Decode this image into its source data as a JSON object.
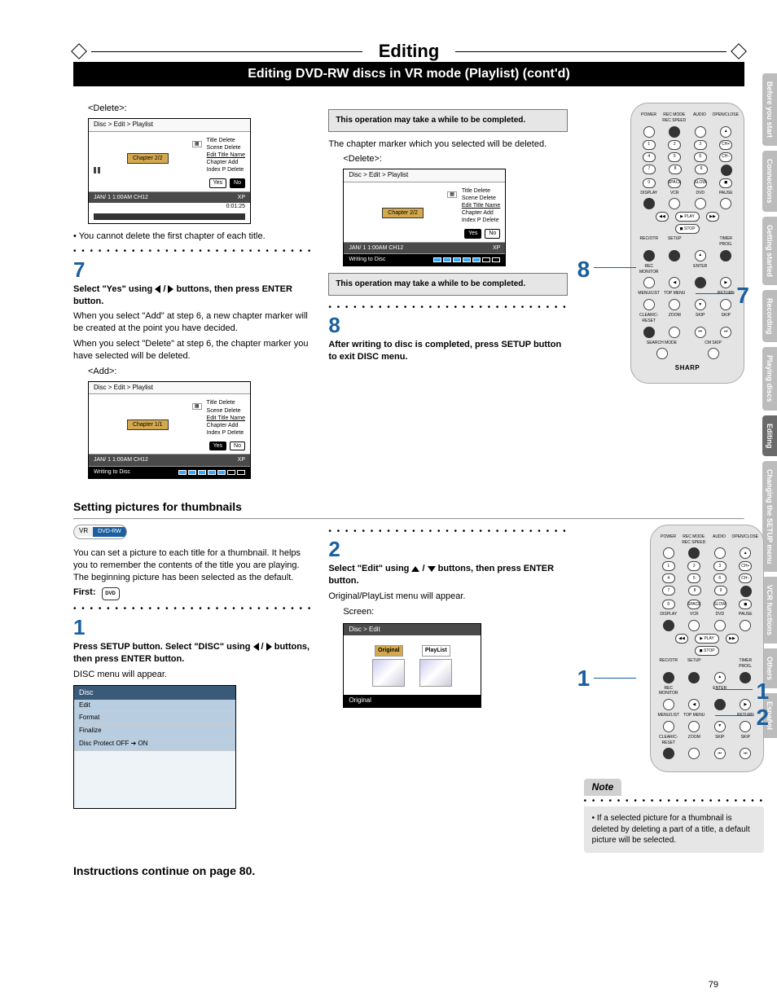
{
  "page_title": "Editing",
  "subtitle": "Editing DVD-RW discs in VR mode (Playlist) (cont'd)",
  "page_number": "79",
  "side_tabs": [
    "Before you start",
    "Connections",
    "Getting started",
    "Recording",
    "Playing discs",
    "Editing",
    "Changing the SETUP menu",
    "VCR functions",
    "Others",
    "Español"
  ],
  "side_tab_active": "Editing",
  "col1": {
    "delete_label": "<Delete>:",
    "screen1": {
      "breadcrumb": "Disc > Edit > Playlist",
      "chapter": "Chapter 2/2",
      "menu": [
        "Title Delete",
        "Scene Delete",
        "Edit Title Name",
        "Chapter Add",
        "Index P Delete"
      ],
      "menu_sel": "Edit Title Name",
      "yes": "Yes",
      "no": "No",
      "footer_left": "JAN/ 1   1:00AM  CH12",
      "footer_mid": "XP",
      "footer_time": "0:01:25"
    },
    "bullet1": "• You cannot delete the first chapter of each title.",
    "step7_num": "7",
    "step7_body": "Select \"Yes\" using ◀ / ▶ buttons, then press ENTER button.",
    "step7_text1": "When you select \"Add\" at step 6, a new chapter marker will be created at the point you have decided.",
    "step7_text2": "When you select \"Delete\" at step 6, the chapter marker you have selected will be deleted.",
    "add_label": "<Add>:",
    "screen2": {
      "breadcrumb": "Disc > Edit > Playlist",
      "chapter": "Chapter 1/1",
      "yes": "Yes",
      "no": "No",
      "footer_left": "JAN/ 1   1:00AM  CH12",
      "footer_mid": "XP",
      "writing": "Writing to Disc"
    }
  },
  "col2": {
    "notice1": "This operation may take a while to be completed.",
    "para1": "The chapter marker which you selected will be deleted.",
    "delete_label": "<Delete>:",
    "screen3": {
      "breadcrumb": "Disc > Edit > Playlist",
      "chapter": "Chapter 2/2",
      "yes": "Yes",
      "no": "No",
      "footer_left": "JAN/ 1   1:00AM  CH12",
      "footer_mid": "XP",
      "writing": "Writing to Disc"
    },
    "notice2": "This operation may take a while to be completed.",
    "step8_num": "8",
    "step8_body": "After writing to disc is completed, press SETUP button to exit DISC menu."
  },
  "col3": {
    "callout8": "8",
    "callout7": "7",
    "remote_brand": "SHARP"
  },
  "section2_title": "Setting pictures for thumbnails",
  "vr_badge_left": "VR",
  "vr_badge_right": "DVD-RW",
  "section2": {
    "intro": "You can set a picture to each title for a thumbnail. It helps you to remember the contents of the title you are playing. The beginning picture has been selected as the default.",
    "first_label": "First:",
    "step1_num": "1",
    "step1_body": "Press SETUP button. Select \"DISC\" using ◀ / ▶ buttons, then press ENTER button.",
    "step1_text": "DISC menu will appear.",
    "disc_head": "Disc",
    "disc_items": [
      "Edit",
      "Format",
      "Finalize",
      "Disc Protect OFF ➔ ON"
    ],
    "step2_num": "2",
    "step2_body": "Select \"Edit\" using ▲ / ▼ buttons, then press ENTER button.",
    "step2_text": "Original/PlayList menu will appear.",
    "screen_label": "Screen:",
    "edit_breadcrumb": "Disc > Edit",
    "thumb1": "Original",
    "thumb2": "PlayList",
    "edit_footer": "Original",
    "callout1_left": "1",
    "callout1_right": "1",
    "callout2_right": "2",
    "note_label": "Note",
    "note_body": "• If a selected picture for a thumbnail is deleted by deleting a part of a title, a default picture will be selected."
  },
  "continue_text": "Instructions continue on page 80."
}
